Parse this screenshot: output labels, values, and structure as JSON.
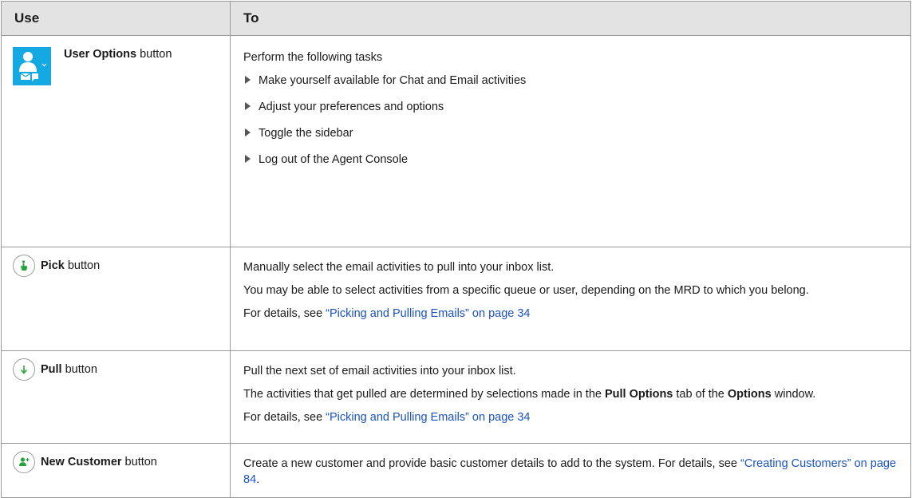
{
  "header": {
    "col_use": "Use",
    "col_to": "To"
  },
  "colors": {
    "user_icon_bg": "#14a9e3",
    "icon_green": "#27a33b",
    "link": "#1a52c4"
  },
  "rows": {
    "user_options": {
      "icon": "user-options-icon",
      "label_bold": "User Options",
      "label_rest": " button",
      "intro": "Perform the following tasks",
      "bullets": [
        "Make yourself available for Chat and Email activities",
        "Adjust your preferences and options",
        "Toggle the sidebar",
        "Log out of the Agent Console"
      ]
    },
    "pick": {
      "icon": "pick-hand-icon",
      "label_bold": "Pick",
      "label_rest": " button",
      "line1": "Manually select the email activities to pull into your inbox list.",
      "line2": "You may be able to select activities from a specific queue or user, depending on the MRD to which you belong.",
      "details_prefix": "For details, see ",
      "details_link": "“Picking and Pulling Emails” on page 34"
    },
    "pull": {
      "icon": "pull-arrow-down-icon",
      "label_bold": "Pull",
      "label_rest": " button",
      "line1": "Pull the next set of email activities into your inbox list.",
      "line2_a": "The activities that get pulled are determined by selections made in the ",
      "line2_b": "Pull Options",
      "line2_c": " tab of the ",
      "line2_d": "Options",
      "line2_e": " window.",
      "details_prefix": "For details, see ",
      "details_link": "“Picking and Pulling Emails” on page 34"
    },
    "new_customer": {
      "icon": "add-customer-icon",
      "label_bold": "New Customer",
      "label_rest": " button",
      "line1": "Create a new customer and provide basic customer details to add to the system. For details, see ",
      "details_link": "“Creating Customers” on page 84",
      "line1_end": "."
    }
  }
}
